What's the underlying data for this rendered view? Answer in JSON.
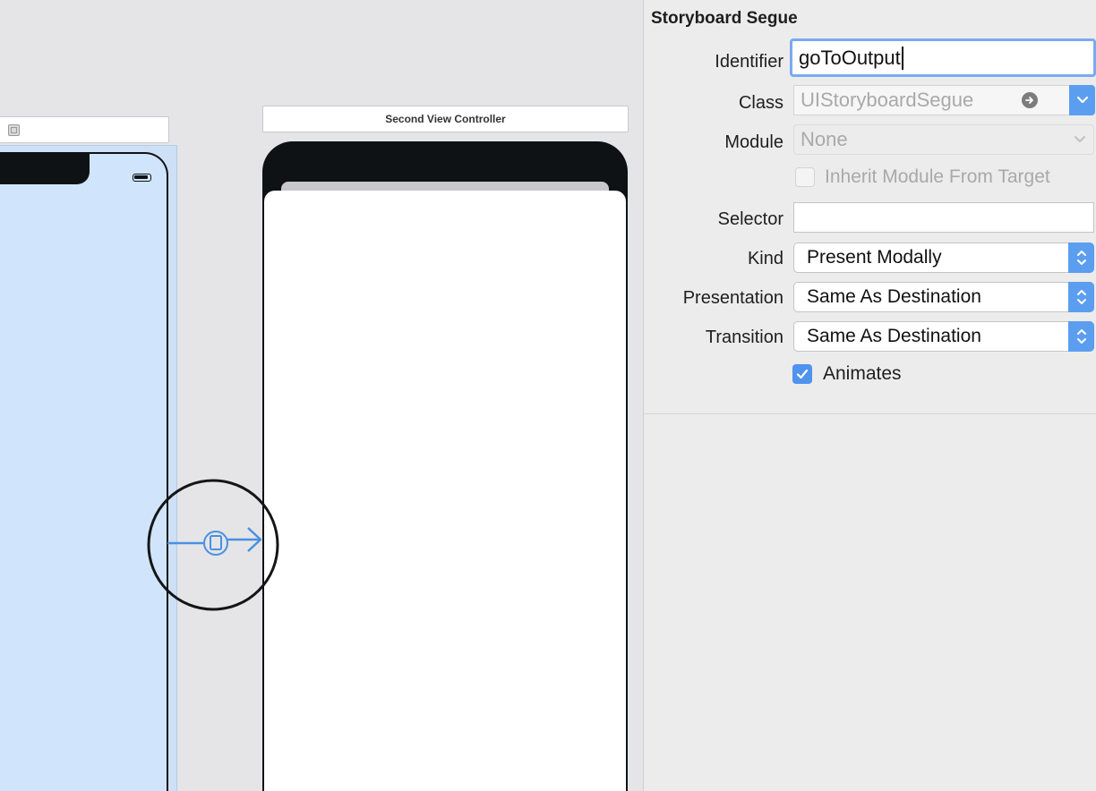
{
  "canvas": {
    "second_scene_title": "Second View Controller"
  },
  "inspector": {
    "section_title": "Storyboard Segue",
    "identifier": {
      "label": "Identifier",
      "value": "goToOutput"
    },
    "class": {
      "label": "Class",
      "placeholder": "UIStoryboardSegue"
    },
    "module": {
      "label": "Module",
      "placeholder": "None"
    },
    "inherit_module": {
      "label": "Inherit Module From Target",
      "checked": false
    },
    "selector": {
      "label": "Selector",
      "value": ""
    },
    "kind": {
      "label": "Kind",
      "value": "Present Modally"
    },
    "presentation": {
      "label": "Presentation",
      "value": "Same As Destination"
    },
    "transition": {
      "label": "Transition",
      "value": "Same As Destination"
    },
    "animates": {
      "label": "Animates",
      "checked": true
    }
  },
  "colors": {
    "accent": "#5b9ef0",
    "selection": "#cde0f6",
    "segue": "#4a90e2",
    "device_frame": "#0f1215"
  },
  "icons": [
    "view-controller-icon",
    "battery-icon",
    "segue-modal-icon",
    "go-arrow-icon",
    "chevron-down-icon",
    "up-down-stepper-icon",
    "checkmark-icon"
  ]
}
